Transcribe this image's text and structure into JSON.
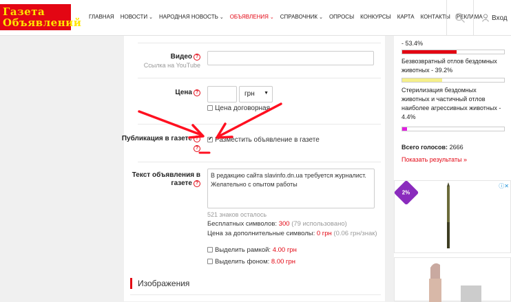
{
  "header": {
    "logo_line1": "Газета",
    "logo_line2": "Объявлений",
    "nav": [
      {
        "label": "Главная",
        "dropdown": false,
        "active": false
      },
      {
        "label": "Новости",
        "dropdown": true,
        "active": false
      },
      {
        "label": "Народная новость",
        "dropdown": true,
        "active": false
      },
      {
        "label": "Объявления",
        "dropdown": true,
        "active": true
      },
      {
        "label": "Справочник",
        "dropdown": true,
        "active": false
      },
      {
        "label": "Опросы",
        "dropdown": false,
        "active": false
      },
      {
        "label": "Конкурсы",
        "dropdown": false,
        "active": false
      },
      {
        "label": "Карта",
        "dropdown": false,
        "active": false
      },
      {
        "label": "Контакты",
        "dropdown": false,
        "active": false
      },
      {
        "label": "Реклама",
        "dropdown": true,
        "active": false
      }
    ],
    "login_label": "Вход"
  },
  "form": {
    "video_label": "Видео",
    "video_sub": "Ссылка на YouTube",
    "video_value": "",
    "price_label": "Цена",
    "price_value": "",
    "currency": "грн",
    "negotiable_label": "Цена договорная",
    "publish_label": "Публикация в газете",
    "publish_checkbox_label": "Разместить объявление в газете",
    "text_label_line1": "Текст объявления в",
    "text_label_line2": "газете",
    "text_value": "В редакцию сайта slavinfo.dn.ua требуется журналист. Желательно с опытом работы",
    "chars_left": "521 знаков осталось",
    "free_symbols_label": "Бесплатных символов:",
    "free_symbols_value": "300",
    "free_symbols_used": "(79 использовано)",
    "extra_price_label": "Цена за дополнительные символы:",
    "extra_price_value": "0 грн",
    "extra_price_rate": "(0.06 грн/знак)",
    "frame_label": "Выделить рамкой:",
    "frame_price": "4.00 грн",
    "bg_label": "Выделить фоном:",
    "bg_price": "8.00 грн",
    "images_title": "Изображения"
  },
  "poll": {
    "items": [
      {
        "text": "- 53.4%",
        "percent": 53.4,
        "color": "#e30613"
      },
      {
        "text": "Безвозвратный отлов бездомных животных - 39.2%",
        "percent": 39.2,
        "color": "#f5ef8a"
      },
      {
        "text": "Стерилизация бездомных животных и частичный отлов наиболее агрессивных животных - 4.4%",
        "percent": 4.4,
        "color": "#e020e0"
      }
    ],
    "total_label": "Всего голосов:",
    "total_value": "2666",
    "results_link": "Показать результаты »"
  },
  "ad": {
    "badge": "2%"
  }
}
